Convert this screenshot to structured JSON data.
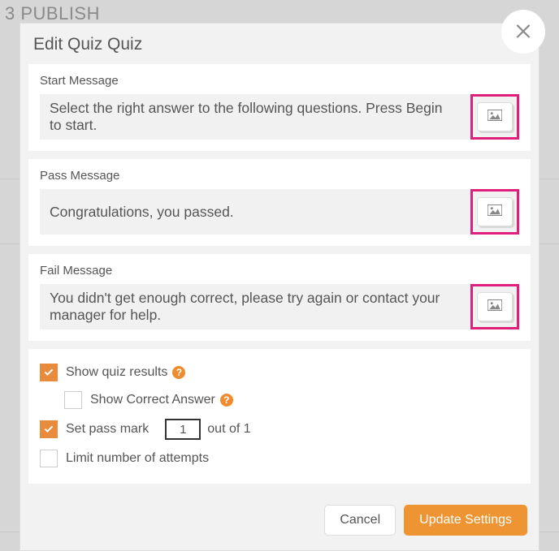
{
  "background": {
    "step_label": "3 PUBLISH"
  },
  "modal": {
    "title": "Edit Quiz Quiz",
    "fields": {
      "start": {
        "label": "Start Message",
        "value": "Select the right answer to the following questions. Press Begin to start."
      },
      "pass": {
        "label": "Pass Message",
        "value": "Congratulations, you passed."
      },
      "fail": {
        "label": "Fail Message",
        "value": "You didn't get enough correct, please try again or contact your manager for help."
      }
    },
    "options": {
      "show_results": {
        "label": "Show quiz results",
        "checked": true
      },
      "show_correct": {
        "label": "Show Correct Answer",
        "checked": false
      },
      "set_passmark": {
        "label": "Set pass mark",
        "checked": true,
        "value": "1",
        "suffix": "out of 1"
      },
      "limit_attempts": {
        "label": "Limit number of attempts",
        "checked": false
      }
    },
    "footer": {
      "cancel": "Cancel",
      "update": "Update Settings"
    },
    "help_glyph": "?"
  }
}
